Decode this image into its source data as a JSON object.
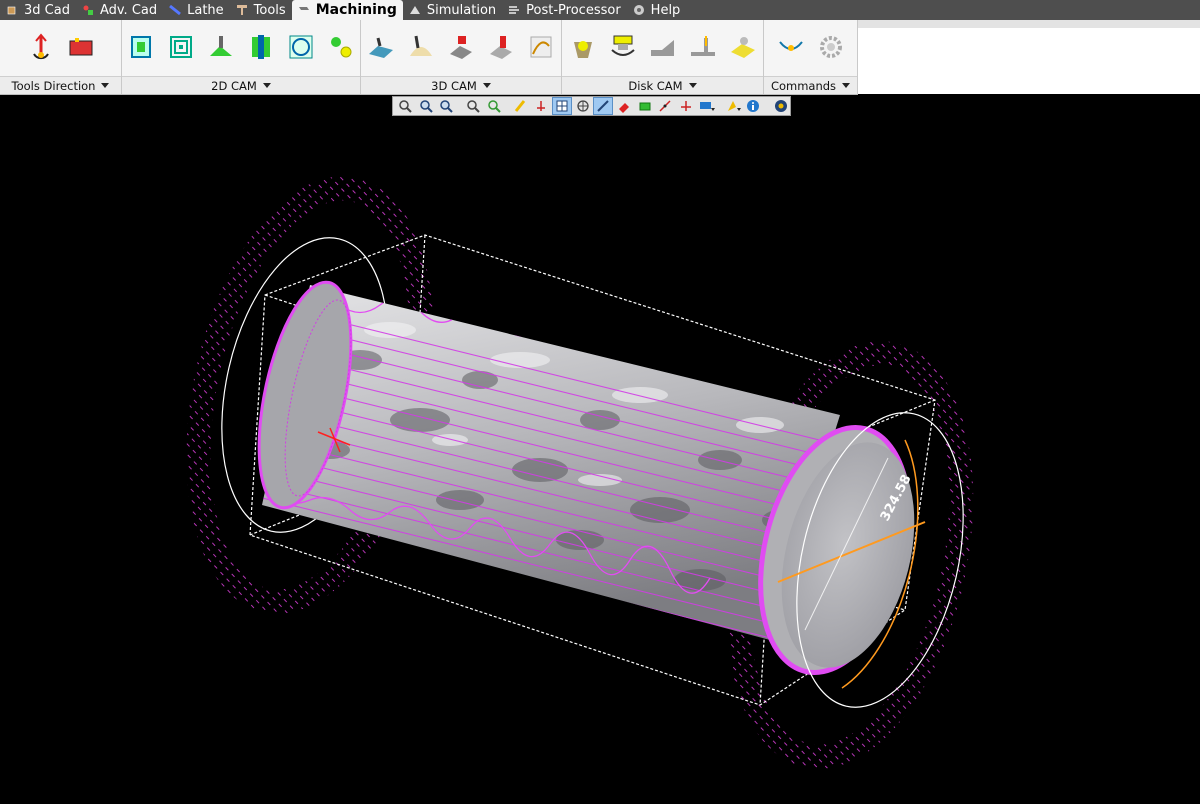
{
  "menu": {
    "items": [
      {
        "label": "3d Cad"
      },
      {
        "label": "Adv. Cad"
      },
      {
        "label": "Lathe"
      },
      {
        "label": "Tools"
      },
      {
        "label": "Machining"
      },
      {
        "label": "Simulation"
      },
      {
        "label": "Post-Processor"
      },
      {
        "label": "Help"
      }
    ]
  },
  "ribbon": {
    "groups": [
      {
        "label": "Tools Direction"
      },
      {
        "label": "2D CAM"
      },
      {
        "label": "3D CAM"
      },
      {
        "label": "Disk CAM"
      },
      {
        "label": "Commands"
      }
    ]
  },
  "viewport": {
    "dimension_text": "324.58"
  },
  "colors": {
    "toolpath": "#e040ff",
    "model": "#b8b8bc",
    "bounding_box": "#ffffff",
    "dimension": "#ff9a1f",
    "background": "#000000"
  }
}
